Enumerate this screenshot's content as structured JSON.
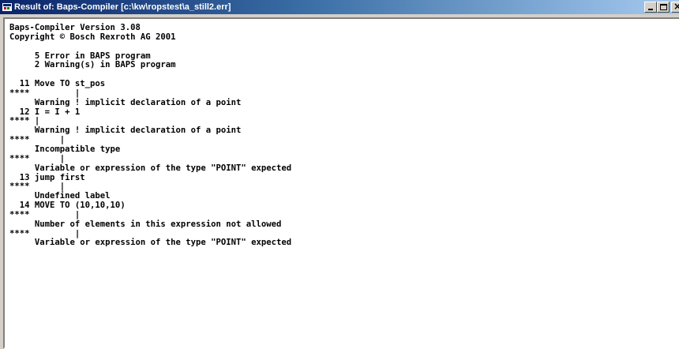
{
  "window": {
    "title": "Result of: Baps-Compiler [c:\\kw\\ropstest\\a_still2.err]",
    "buttons": {
      "minimize": "minimize",
      "maximize": "maximize",
      "close": "close"
    }
  },
  "output": {
    "lines": [
      "Baps-Compiler Version 3.08",
      "Copyright © Bosch Rexroth AG 2001",
      "",
      "     5 Error in BAPS program",
      "     2 Warning(s) in BAPS program",
      "",
      "  11 Move TO st_pos",
      "****         |",
      "     Warning ! implicit declaration of a point",
      "  12 I = I + 1",
      "**** |",
      "     Warning ! implicit declaration of a point",
      "****      |",
      "     Incompatible type",
      "****      |",
      "     Variable or expression of the type \"POINT\" expected",
      "  13 jump first",
      "****      |",
      "     Undefined label",
      "  14 MOVE TO (10,10,10)",
      "****         |",
      "     Number of elements in this expression not allowed",
      "****         |",
      "     Variable or expression of the type \"POINT\" expected"
    ]
  }
}
